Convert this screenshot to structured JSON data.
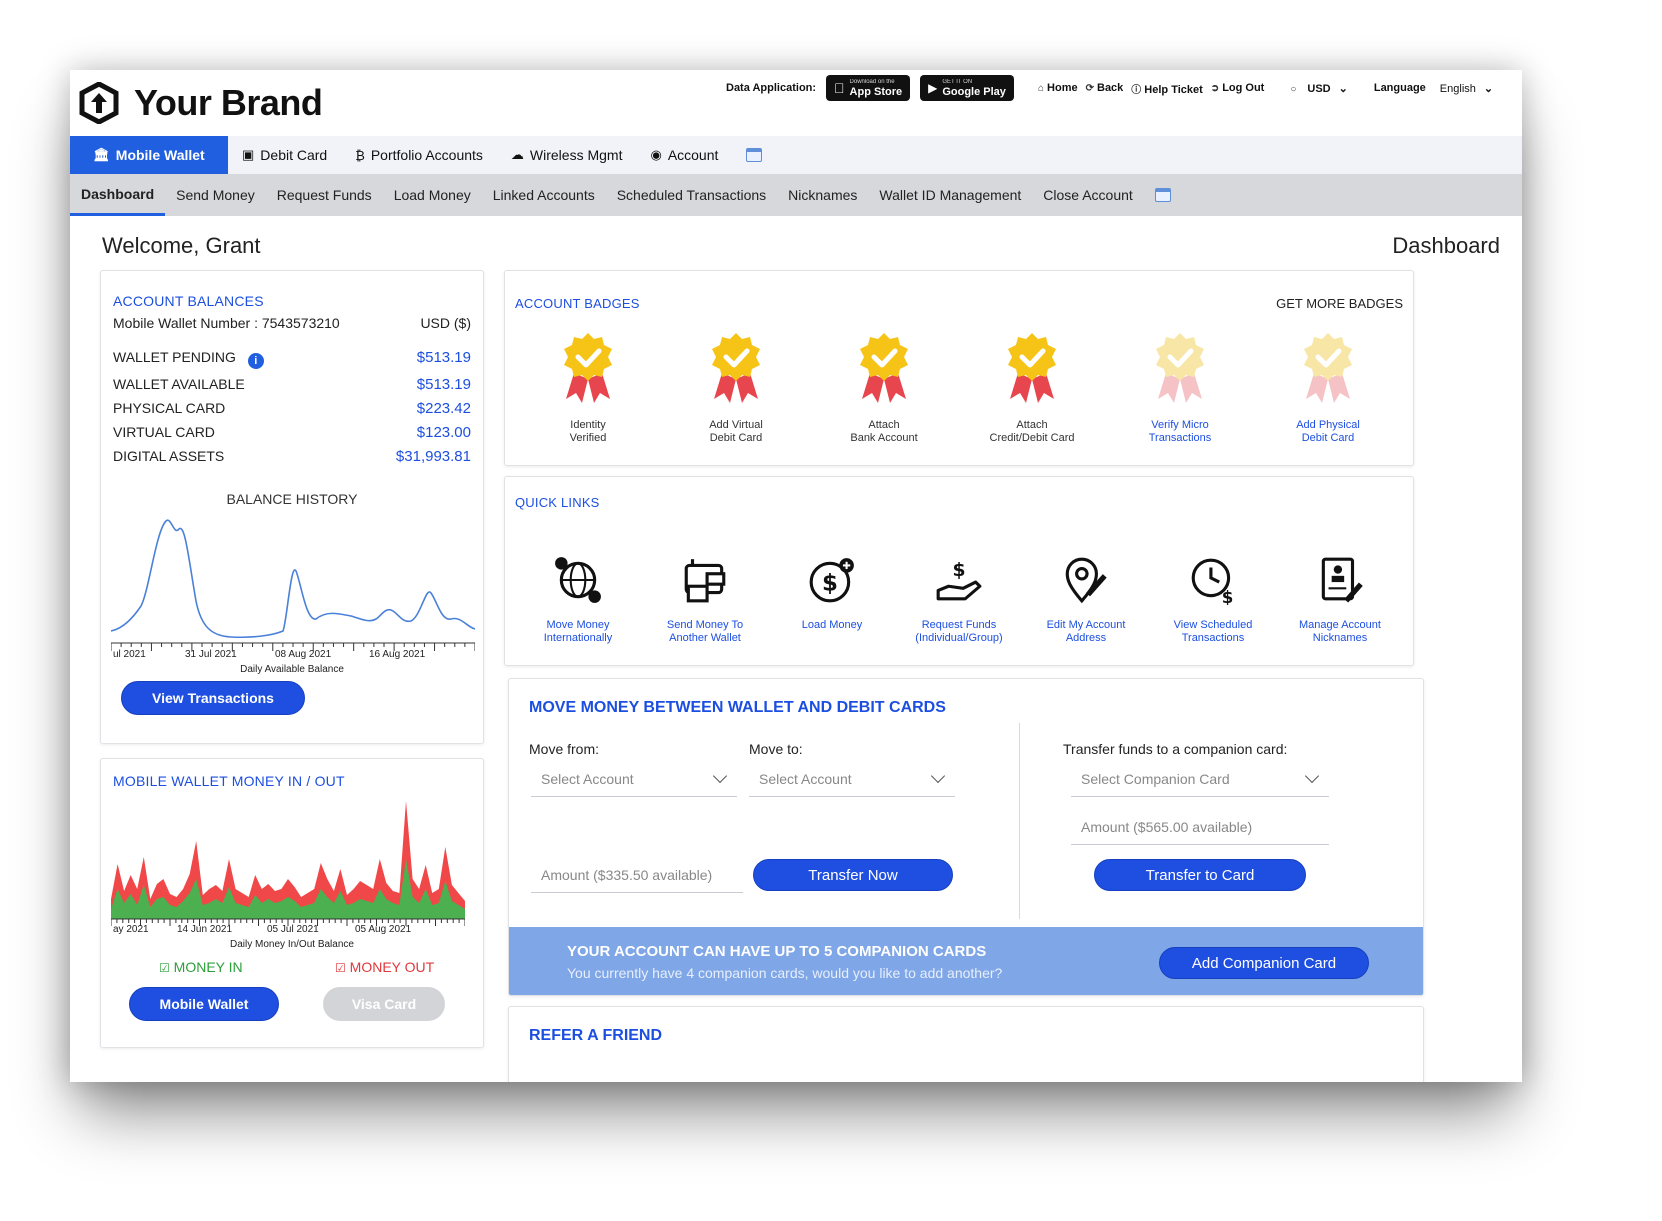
{
  "brand": {
    "name": "Your Brand"
  },
  "topbar": {
    "data_app_label": "Data Application:",
    "app_store_small": "Download on the",
    "app_store": "App Store",
    "google_small": "GET IT ON",
    "google_play": "Google Play",
    "links": [
      "Home",
      "Back",
      "Help Ticket",
      "Log Out"
    ],
    "currency": "USD",
    "language_label": "Language",
    "language": "English"
  },
  "main_tabs": [
    "Mobile Wallet",
    "Debit Card",
    "Portfolio Accounts",
    "Wireless Mgmt",
    "Account"
  ],
  "sub_tabs": [
    "Dashboard",
    "Send Money",
    "Request Funds",
    "Load Money",
    "Linked Accounts",
    "Scheduled Transactions",
    "Nicknames",
    "Wallet ID Management",
    "Close Account"
  ],
  "welcome": "Welcome, Grant",
  "page_title": "Dashboard",
  "balances": {
    "title": "ACCOUNT BALANCES",
    "wallet_number": "Mobile Wallet Number : 7543573210",
    "currency": "USD ($)",
    "rows": [
      {
        "label": "WALLET PENDING",
        "value": "$513.19"
      },
      {
        "label": "WALLET AVAILABLE",
        "value": "$513.19"
      },
      {
        "label": "PHYSICAL CARD",
        "value": "$223.42"
      },
      {
        "label": "VIRTUAL CARD",
        "value": "$123.00"
      },
      {
        "label": "DIGITAL ASSETS",
        "value": "$31,993.81"
      }
    ],
    "history_title": "BALANCE HISTORY",
    "history_ticks": [
      "ul 2021",
      "31 Jul 2021",
      "08 Aug 2021",
      "16 Aug 2021"
    ],
    "history_caption": "Daily Available Balance",
    "view_transactions": "View Transactions"
  },
  "money_inout": {
    "title": "MOBILE WALLET MONEY IN / OUT",
    "ticks": [
      "ay 2021",
      "14 Jun 2021",
      "05 Jul 2021",
      "05 Aug 2021"
    ],
    "caption": "Daily Money In/Out Balance",
    "legend_in": "MONEY IN",
    "legend_out": "MONEY OUT",
    "btn_wallet": "Mobile Wallet",
    "btn_visa": "Visa Card"
  },
  "badges": {
    "title": "ACCOUNT BADGES",
    "more": "GET MORE BADGES",
    "items": [
      {
        "line1": "Identity",
        "line2": "Verified"
      },
      {
        "line1": "Add Virtual",
        "line2": "Debit Card"
      },
      {
        "line1": "Attach",
        "line2": "Bank Account"
      },
      {
        "line1": "Attach",
        "line2": "Credit/Debit Card"
      },
      {
        "line1": "Verify Micro",
        "line2": "Transactions"
      },
      {
        "line1": "Add Physical",
        "line2": "Debit Card"
      }
    ]
  },
  "quick_links": {
    "title": "QUICK LINKS",
    "items": [
      {
        "line1": "Move Money",
        "line2": "Internationally"
      },
      {
        "line1": "Send Money To",
        "line2": "Another Wallet"
      },
      {
        "line1": "Load Money",
        "line2": ""
      },
      {
        "line1": "Request Funds",
        "line2": "(Individual/Group)"
      },
      {
        "line1": "Edit My Account",
        "line2": "Address"
      },
      {
        "line1": "View Scheduled",
        "line2": "Transactions"
      },
      {
        "line1": "Manage Account",
        "line2": "Nicknames"
      }
    ]
  },
  "move_money": {
    "title": "MOVE MONEY BETWEEN WALLET AND DEBIT CARDS",
    "from_label": "Move from:",
    "to_label": "Move to:",
    "from_placeholder": "Select Account",
    "to_placeholder": "Select Account",
    "amount_placeholder": "Amount ($335.50 available)",
    "transfer_now": "Transfer Now",
    "companion_label": "Transfer funds to a companion card:",
    "companion_placeholder": "Select Companion Card",
    "companion_amount": "Amount ($565.00 available)",
    "transfer_card": "Transfer to Card",
    "banner_title": "YOUR ACCOUNT CAN HAVE UP TO 5 COMPANION CARDS",
    "banner_sub": "You currently have 4 companion cards, would you like to add another?",
    "add_companion": "Add Companion Card"
  },
  "refer": {
    "title": "REFER A FRIEND"
  },
  "colors": {
    "accent": "#1f5fe0",
    "money_in": "#4caf50",
    "money_out": "#f04848",
    "badge_gold": "#f6c416",
    "ribbon": "#e8464e"
  },
  "icons": {
    "logo": "hexagon-arrow-logo",
    "info": "info-icon",
    "calendar": "calendar-icon"
  }
}
